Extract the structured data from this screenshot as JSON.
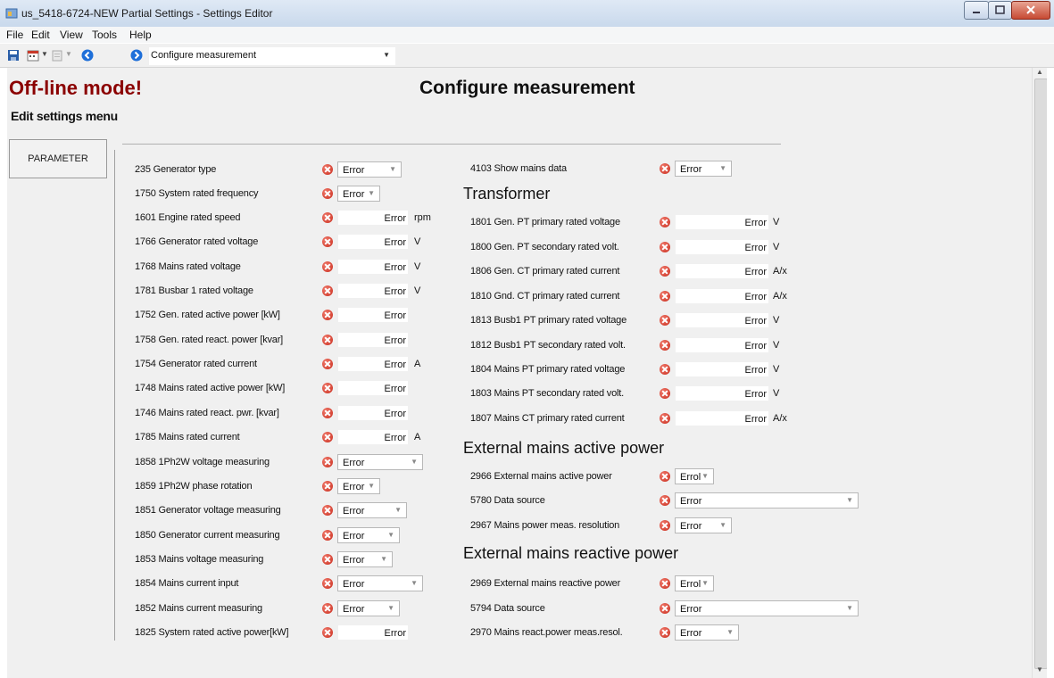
{
  "window": {
    "title": "us_5418-6724-NEW Partial Settings - Settings Editor"
  },
  "menu": [
    "File",
    "Edit",
    "View",
    "Tools",
    "Help"
  ],
  "toolbar": {
    "nav_combo_value": "Configure measurement"
  },
  "header": {
    "offline": "Off-line mode!",
    "title": "Configure measurement",
    "edit_menu": "Edit settings menu",
    "parameter_button": "PARAMETER"
  },
  "left_params": [
    {
      "label": "235 Generator type",
      "value": "Error",
      "unit": ""
    },
    {
      "label": "1750 System rated frequency",
      "value": "Error",
      "unit": ""
    },
    {
      "label": "1601 Engine rated speed",
      "value": "Error",
      "unit": "rpm"
    },
    {
      "label": "1766 Generator rated voltage",
      "value": "Error",
      "unit": "V"
    },
    {
      "label": "1768 Mains rated voltage",
      "value": "Error",
      "unit": "V"
    },
    {
      "label": "1781 Busbar 1 rated voltage",
      "value": "Error",
      "unit": "V"
    },
    {
      "label": "1752 Gen. rated active power [kW]",
      "value": "Error",
      "unit": ""
    },
    {
      "label": "1758 Gen. rated react. power [kvar]",
      "value": "Error",
      "unit": ""
    },
    {
      "label": "1754 Generator rated current",
      "value": "Error",
      "unit": "A"
    },
    {
      "label": "1748 Mains rated active power [kW]",
      "value": "Error",
      "unit": ""
    },
    {
      "label": "1746 Mains rated react. pwr. [kvar]",
      "value": "Error",
      "unit": ""
    },
    {
      "label": "1785 Mains rated current",
      "value": "Error",
      "unit": "A"
    },
    {
      "label": "1858 1Ph2W voltage measuring",
      "value": "Error",
      "unit": ""
    },
    {
      "label": "1859 1Ph2W phase rotation",
      "value": "Error",
      "unit": ""
    },
    {
      "label": "1851 Generator voltage measuring",
      "value": "Error",
      "unit": ""
    },
    {
      "label": "1850 Generator current measuring",
      "value": "Error",
      "unit": ""
    },
    {
      "label": "1853 Mains voltage measuring",
      "value": "Error",
      "unit": ""
    },
    {
      "label": "1854 Mains current input",
      "value": "Error",
      "unit": ""
    },
    {
      "label": "1852 Mains current measuring",
      "value": "Error",
      "unit": ""
    },
    {
      "label": "1825 System rated active power[kW]",
      "value": "Error",
      "unit": ""
    }
  ],
  "right_top": {
    "label": "4103 Show mains data",
    "value": "Error"
  },
  "sections": {
    "transformer": "Transformer",
    "ext_active": "External mains active power",
    "ext_reactive": "External mains reactive power"
  },
  "transformer_params": [
    {
      "label": "1801 Gen. PT primary rated voltage",
      "value": "Error",
      "unit": "V"
    },
    {
      "label": "1800 Gen. PT secondary rated volt.",
      "value": "Error",
      "unit": "V"
    },
    {
      "label": "1806 Gen. CT primary rated current",
      "value": "Error",
      "unit": "A/x"
    },
    {
      "label": "1810 Gnd. CT primary rated current",
      "value": "Error",
      "unit": "A/x"
    },
    {
      "label": "1813 Busb1 PT primary rated voltage",
      "value": "Error",
      "unit": "V"
    },
    {
      "label": "1812 Busb1 PT secondary rated volt.",
      "value": "Error",
      "unit": "V"
    },
    {
      "label": "1804 Mains PT primary rated voltage",
      "value": "Error",
      "unit": "V"
    },
    {
      "label": "1803 Mains PT secondary rated volt.",
      "value": "Error",
      "unit": "V"
    },
    {
      "label": "1807 Mains CT primary rated current",
      "value": "Error",
      "unit": "A/x"
    }
  ],
  "ext_active_params": [
    {
      "label": "2966 External mains active power",
      "value": "Errol"
    },
    {
      "label": "5780 Data source",
      "value": "Error"
    },
    {
      "label": "2967 Mains power meas. resolution",
      "value": "Error"
    }
  ],
  "ext_reactive_params": [
    {
      "label": "2969 External mains reactive power",
      "value": "Errol"
    },
    {
      "label": "5794 Data source",
      "value": "Error"
    },
    {
      "label": "2970 Mains react.power meas.resol.",
      "value": "Error"
    }
  ],
  "colors": {
    "offline": "#8b0000",
    "error_icon": "#c92a1b",
    "background": "#f0f0f0"
  }
}
